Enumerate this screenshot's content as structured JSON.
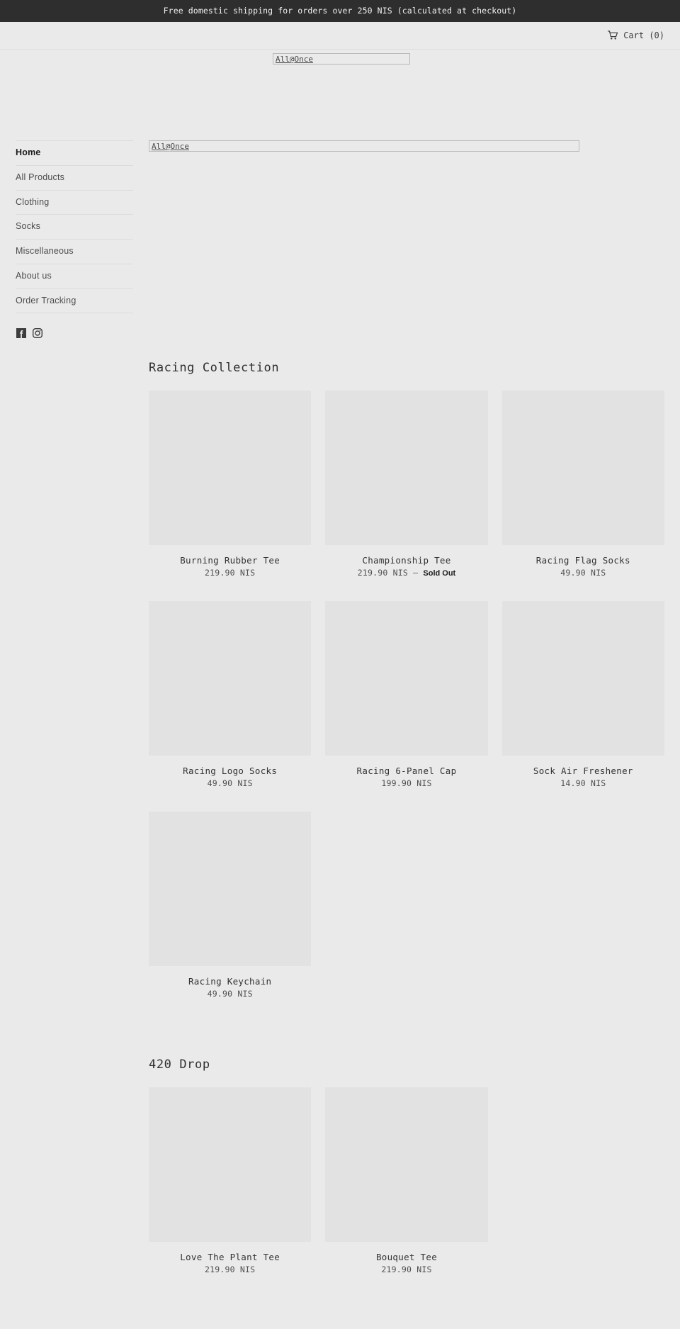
{
  "announcement": {
    "text": "Free domestic shipping for orders over 250 NIS (calculated at checkout)"
  },
  "header": {
    "cart_label": "Cart (0)",
    "cart_icon": "shopping-cart-icon",
    "logo_alt": "All@Once"
  },
  "hero": {
    "image_alt": "All@Once"
  },
  "sidebar": {
    "items": [
      {
        "label": "Home",
        "active": true
      },
      {
        "label": "All Products",
        "active": false
      },
      {
        "label": "Clothing",
        "active": false
      },
      {
        "label": "Socks",
        "active": false
      },
      {
        "label": "Miscellaneous",
        "active": false
      },
      {
        "label": "About us",
        "active": false
      },
      {
        "label": "Order Tracking",
        "active": false
      }
    ],
    "social": [
      {
        "name": "facebook-icon",
        "label": "Facebook"
      },
      {
        "name": "instagram-icon",
        "label": "Instagram"
      }
    ]
  },
  "collections": [
    {
      "title": "Racing Collection",
      "products": [
        {
          "title": "Burning Rubber Tee",
          "price": "219.90 NIS",
          "separator": "",
          "status": ""
        },
        {
          "title": "Championship Tee",
          "price": "219.90 NIS",
          "separator": "—",
          "status": "Sold Out"
        },
        {
          "title": "Racing Flag Socks",
          "price": "49.90 NIS",
          "separator": "",
          "status": ""
        },
        {
          "title": "Racing Logo Socks",
          "price": "49.90 NIS",
          "separator": "",
          "status": ""
        },
        {
          "title": "Racing 6-Panel Cap",
          "price": "199.90 NIS",
          "separator": "",
          "status": ""
        },
        {
          "title": "Sock Air Freshener",
          "price": "14.90 NIS",
          "separator": "",
          "status": ""
        },
        {
          "title": "Racing Keychain",
          "price": "49.90 NIS",
          "separator": "",
          "status": ""
        }
      ]
    },
    {
      "title": "420 Drop",
      "products": [
        {
          "title": "Love The Plant Tee",
          "price": "219.90 NIS",
          "separator": "",
          "status": ""
        },
        {
          "title": "Bouquet Tee",
          "price": "219.90 NIS",
          "separator": "",
          "status": ""
        }
      ]
    }
  ],
  "colors": {
    "page_background": "#eaeaea",
    "announcement_background": "#2e2e2e",
    "announcement_text": "#f2f2f2",
    "thumb_placeholder": "#e2e2e2",
    "text": "#3d3d3d",
    "divider": "#dcdcdc"
  }
}
